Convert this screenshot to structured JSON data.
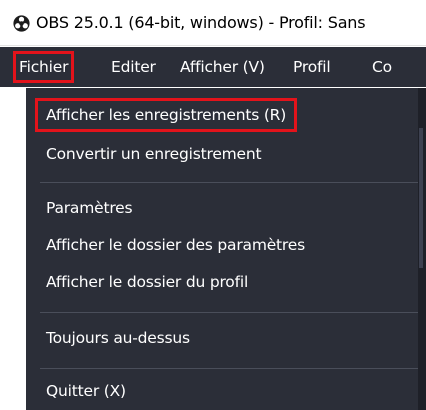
{
  "window": {
    "title": "OBS 25.0.1 (64-bit, windows) - Profil: Sans",
    "icon": "obs-logo-icon"
  },
  "menubar": {
    "items": [
      {
        "label": "Fichier"
      },
      {
        "label": "Editer"
      },
      {
        "label": "Afficher (V)"
      },
      {
        "label": "Profil"
      },
      {
        "label": "Co"
      }
    ]
  },
  "file_menu": {
    "items": [
      {
        "label": "Afficher les enregistrements (R)"
      },
      {
        "label": "Convertir un enregistrement"
      },
      {
        "label": "Paramètres"
      },
      {
        "label": "Afficher le dossier des paramètres"
      },
      {
        "label": "Afficher le dossier du profil"
      },
      {
        "label": "Toujours au-dessus"
      },
      {
        "label": "Quitter (X)"
      }
    ]
  },
  "colors": {
    "menu_background": "#2b2e38",
    "menu_text": "#ffffff",
    "highlight_border": "#e3131b",
    "titlebar_background": "#ffffff"
  }
}
